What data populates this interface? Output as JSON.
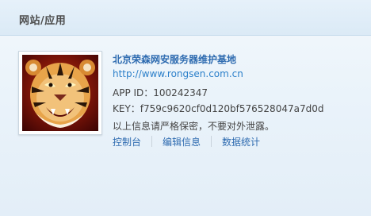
{
  "header": {
    "title": "网站/应用"
  },
  "app": {
    "avatar_icon": "tiger-icon",
    "name": "北京荣森网安服务器维护基地",
    "url": "http://www.rongsen.com.cn",
    "app_id_label": "APP ID：",
    "app_id": "100242347",
    "key_label": "KEY：",
    "key": "f759c9620cf0d120bf576528047a7d0d",
    "note": "以上信息请严格保密，不要对外泄露。"
  },
  "actions": [
    {
      "label": "控制台"
    },
    {
      "label": "编辑信息"
    },
    {
      "label": "数据统计"
    }
  ],
  "colors": {
    "link": "#2e6bb0",
    "header_bg": "#dbeaf6",
    "text": "#444444"
  }
}
